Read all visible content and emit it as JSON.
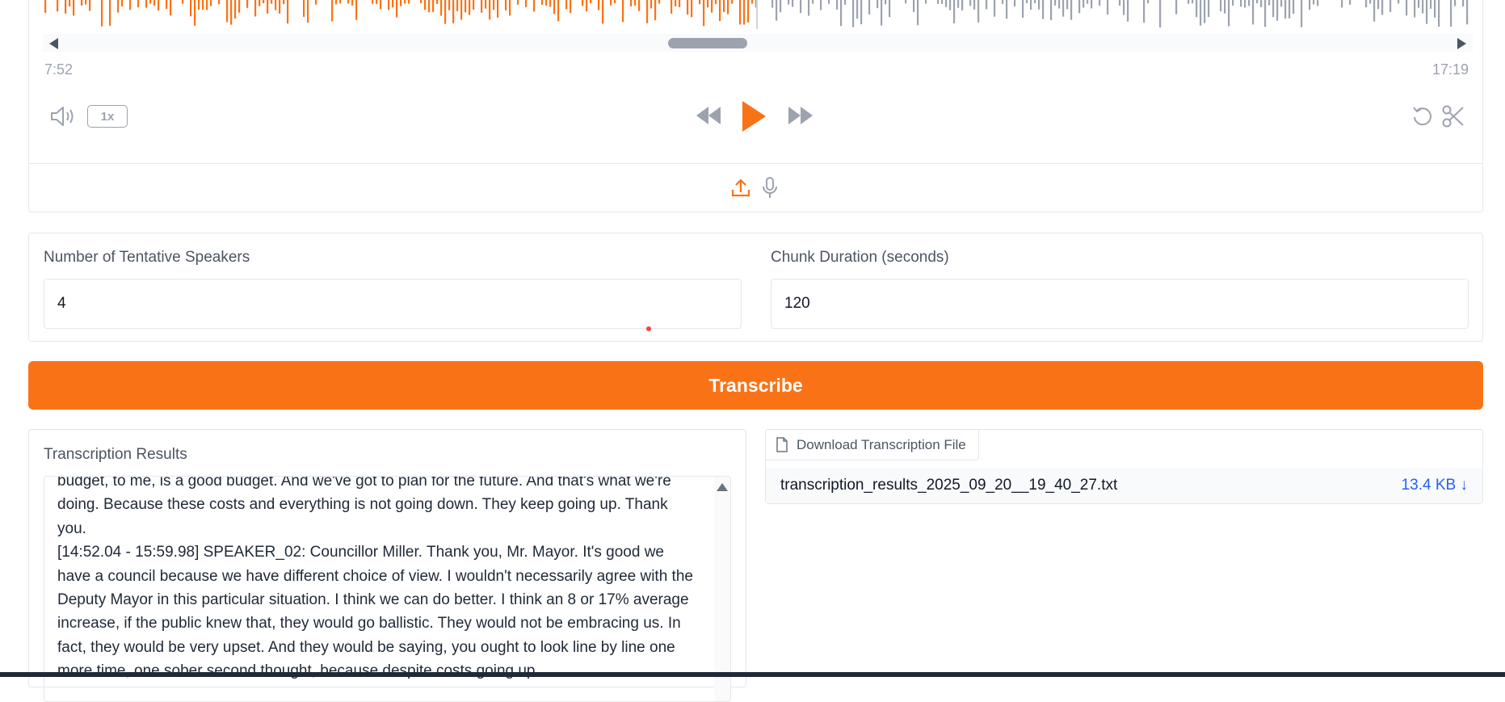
{
  "player": {
    "time_start": "7:52",
    "time_end": "17:19",
    "speed": "1x",
    "progress_fraction": 0.5,
    "colors": {
      "played": "#f97316",
      "unplayed": "#9ca3af"
    },
    "icons": [
      "volume-icon",
      "rewind-icon",
      "play-icon",
      "fast-forward-icon",
      "undo-icon",
      "scissors-icon",
      "upload-icon",
      "microphone-icon"
    ]
  },
  "settings": {
    "speakers_label": "Number of Tentative Speakers",
    "speakers_value": "4",
    "chunk_label": "Chunk Duration (seconds)",
    "chunk_value": "120"
  },
  "actions": {
    "transcribe_label": "Transcribe"
  },
  "results": {
    "label": "Transcription Results",
    "text": "budget, to me, is a good budget. And we've got to plan for the future. And that's what we're doing. Because these costs and everything is not going down. They keep going up. Thank you.\n[14:52.04 - 15:59.98] SPEAKER_02: Councillor Miller. Thank you, Mr. Mayor. It's good we have a council because we have different choice of view. I wouldn't necessarily agree with the Deputy Mayor in this particular situation. I think we can do better. I think an 8 or 17% average increase, if the public knew that, they would go ballistic. They would not be embracing us. In fact, they would be very upset. And they would be saying, you ought to look line by line one more time, one sober second thought, because despite costs going up"
  },
  "download": {
    "header_label": "Download Transcription File",
    "file_name": "transcription_results_2025_09_20__19_40_27.txt",
    "file_size": "13.4 KB ↓"
  },
  "colors": {
    "accent": "#f97316",
    "link": "#2563eb"
  }
}
